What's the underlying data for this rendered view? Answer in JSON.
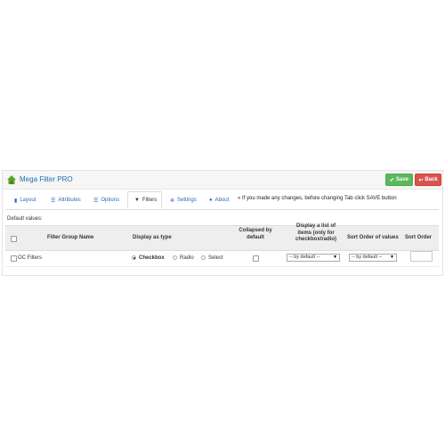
{
  "header": {
    "title": "Mega Filter PRO",
    "save_label": "Save",
    "back_label": "Back"
  },
  "tabs": [
    {
      "label": "Layout",
      "icon": "document-icon",
      "active": false
    },
    {
      "label": "Attributes",
      "icon": "list-icon",
      "active": false
    },
    {
      "label": "Options",
      "icon": "list-icon",
      "active": false
    },
    {
      "label": "Filters",
      "icon": "filter-icon",
      "active": true
    },
    {
      "label": "Settings",
      "icon": "gear-icon",
      "active": false
    },
    {
      "label": "About",
      "icon": "question-icon",
      "active": false
    }
  ],
  "notice": "« If you made any changes, before changing Tab click SAVE button",
  "section_title": "Default values:",
  "table": {
    "columns": {
      "name": "Filter Group Name",
      "display_as": "Display as type",
      "collapsed": [
        "Collapsed by",
        "default"
      ],
      "display_list": [
        "Display a list of",
        "items (only for",
        "checkbox/radio)"
      ],
      "sort_values": "Sort Order of values",
      "sort_order": "Sort Order"
    },
    "row": {
      "name": "OC Filters",
      "type_options": [
        "Checkbox",
        "Radio",
        "Select"
      ],
      "type_selected": "Checkbox",
      "display_list_value": "-- by default --",
      "sort_values_value": "-- by default --",
      "sort_order_value": ""
    }
  },
  "colors": {
    "save": "#5cb85c",
    "back": "#d9534f",
    "link": "#2a6bb0"
  }
}
